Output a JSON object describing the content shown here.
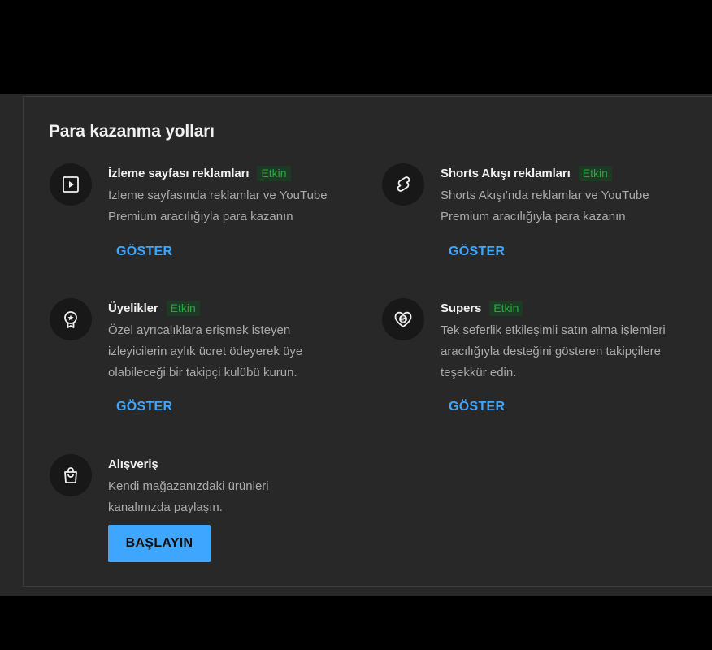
{
  "card": {
    "title": "Para kazanma yolları"
  },
  "features": [
    {
      "name": "İzleme sayfası reklamları",
      "badge": "Etkin",
      "description": "İzleme sayfasında reklamlar ve YouTube Premium aracılığıyla para kazanın",
      "action": "GÖSTER",
      "icon": "play-square-icon"
    },
    {
      "name": "Shorts Akışı reklamları",
      "badge": "Etkin",
      "description": "Shorts Akışı'nda reklamlar ve YouTube Premium aracılığıyla para kazanın",
      "action": "GÖSTER",
      "icon": "shorts-icon"
    },
    {
      "name": "Üyelikler",
      "badge": "Etkin",
      "description": "Özel ayrıcalıklara erişmek isteyen izleyicilerin aylık ücret ödeyerek üye olabileceği bir takipçi kulübü kurun.",
      "action": "GÖSTER",
      "icon": "membership-badge-icon"
    },
    {
      "name": "Supers",
      "badge": "Etkin",
      "description": "Tek seferlik etkileşimli satın alma işlemleri aracılığıyla desteğini gösteren takipçilere teşekkür edin.",
      "action": "GÖSTER",
      "icon": "heart-dollar-icon"
    },
    {
      "name": "Alışveriş",
      "description": "Kendi mağazanızdaki ürünleri kanalınızda paylaşın.",
      "action": "BAŞLAYIN",
      "icon": "shopping-bag-icon"
    }
  ],
  "colors": {
    "accent": "#3ea6ff",
    "badge_text": "#2ba640",
    "surface": "#282828",
    "icon_bg": "#181818"
  }
}
